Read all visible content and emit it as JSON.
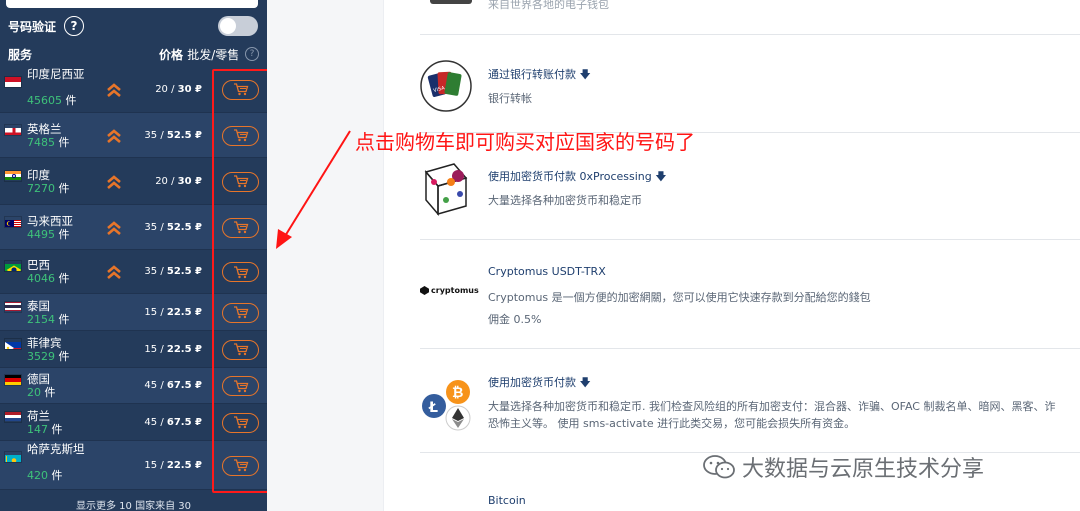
{
  "sidebar": {
    "verify_label": "号码验证",
    "help_glyph": "?",
    "header_service": "服务",
    "header_price": "价格",
    "header_price_sub": "批发/零售",
    "header_help_glyph": "?",
    "more_text": "显示更多 10 国家来自 30",
    "countries": [
      {
        "name": "印度尼西亚",
        "count": "45605",
        "unit": "件",
        "price_low": "20",
        "price_high": "30 ₽",
        "chevron": true,
        "flag": "indonesia"
      },
      {
        "name": "英格兰",
        "count": "7485",
        "unit": "件",
        "price_low": "35",
        "price_high": "52.5 ₽",
        "chevron": true,
        "flag": "england"
      },
      {
        "name": "印度",
        "count": "7270",
        "unit": "件",
        "price_low": "20",
        "price_high": "30 ₽",
        "chevron": true,
        "flag": "india"
      },
      {
        "name": "马来西亚",
        "count": "4495",
        "unit": "件",
        "price_low": "35",
        "price_high": "52.5 ₽",
        "chevron": true,
        "flag": "malaysia"
      },
      {
        "name": "巴西",
        "count": "4046",
        "unit": "件",
        "price_low": "35",
        "price_high": "52.5 ₽",
        "chevron": true,
        "flag": "brazil"
      },
      {
        "name": "泰国",
        "count": "2154",
        "unit": "件",
        "price_low": "15",
        "price_high": "22.5 ₽",
        "chevron": false,
        "flag": "thailand"
      },
      {
        "name": "菲律宾",
        "count": "3529",
        "unit": "件",
        "price_low": "15",
        "price_high": "22.5 ₽",
        "chevron": false,
        "flag": "philippines"
      },
      {
        "name": "德国",
        "count": "20",
        "unit": "件",
        "price_low": "45",
        "price_high": "67.5 ₽",
        "chevron": false,
        "flag": "germany"
      },
      {
        "name": "荷兰",
        "count": "147",
        "unit": "件",
        "price_low": "45",
        "price_high": "67.5 ₽",
        "chevron": false,
        "flag": "netherlands"
      },
      {
        "name": "哈萨克斯坦",
        "count": "420",
        "unit": "件",
        "price_low": "15",
        "price_high": "22.5 ₽",
        "chevron": false,
        "flag": "kazakhstan"
      }
    ]
  },
  "payments": {
    "top_partial": "来自世界各地的电子钱包",
    "bank": {
      "title": "通过银行转账付款",
      "sub": "银行转帐"
    },
    "oxprocessing": {
      "title": "使用加密货币付款 0xProcessing",
      "sub": "大量选择各种加密货币和稳定币"
    },
    "cryptomus": {
      "title": "Cryptomus USDT-TRX",
      "logo_text": "cryptomus",
      "sub": "Cryptomus 是一個方便的加密網關，您可以使用它快速存款到分配給您的錢包",
      "sub2": "佣金 0.5%"
    },
    "crypto": {
      "title": "使用加密货币付款",
      "sub": "大量选择各种加密货币和稳定币. 我们检查风险组的所有加密支付：混合器、诈骗、OFAC 制裁名单、暗网、黑客、诈",
      "sub2": "恐怖主义等。 使用 sms-activate 进行此类交易，您可能会损失所有资金。"
    },
    "bitcoin": {
      "title": "Bitcoin"
    }
  },
  "annotation": "点击购物车即可购买对应国家的号码了",
  "watermark": "大数据与云原生技术分享",
  "colors": {
    "sidebar_bg": "#243b5b",
    "accent_orange": "#e7752a",
    "count_green": "#3ec27a",
    "annotation_red": "#ff1414"
  }
}
